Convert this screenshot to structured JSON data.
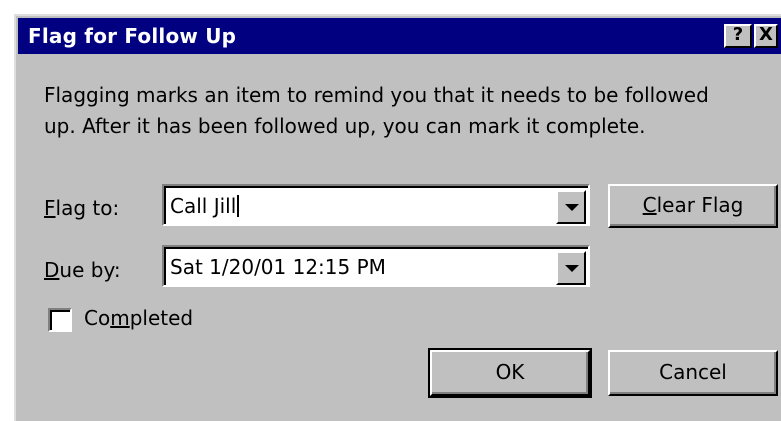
{
  "window": {
    "title": "Flag for Follow Up",
    "help_label": "?",
    "close_label": "X"
  },
  "description": "Flagging marks an item to remind you that it needs to be followed up.  After it has been followed up, you can mark it complete.",
  "flag_to": {
    "label_acc": "F",
    "label_rest": "lag to:",
    "value": "Call Jill"
  },
  "due_by": {
    "label_acc": "D",
    "label_rest": "ue by:",
    "value": "Sat 1/20/01 12:15 PM"
  },
  "completed": {
    "label_pre": "Co",
    "label_acc": "m",
    "label_post": "pleted",
    "checked": false
  },
  "buttons": {
    "clear_flag_acc": "C",
    "clear_flag_rest": "lear Flag",
    "ok": "OK",
    "cancel": "Cancel"
  }
}
